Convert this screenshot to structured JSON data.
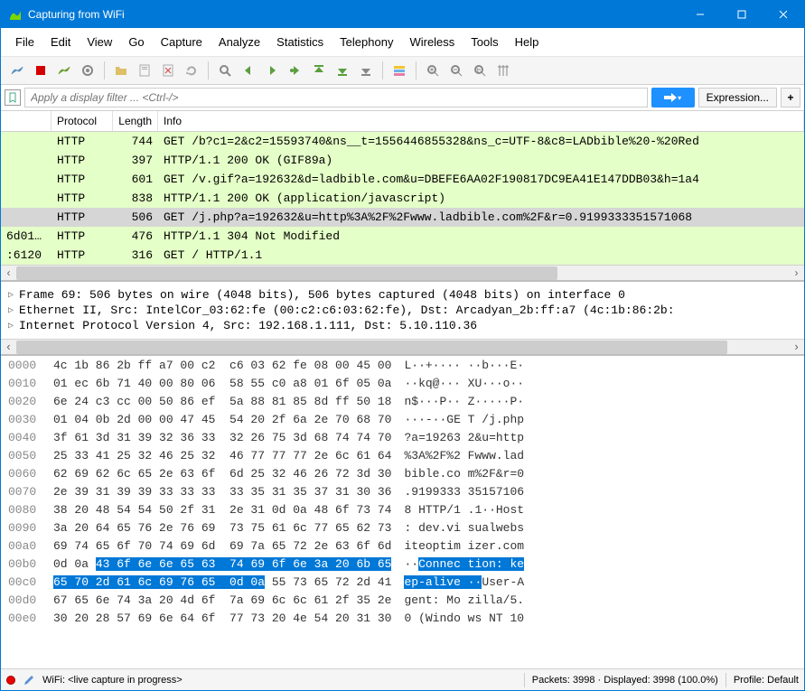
{
  "window": {
    "title": "Capturing from WiFi"
  },
  "menu": [
    "File",
    "Edit",
    "View",
    "Go",
    "Capture",
    "Analyze",
    "Statistics",
    "Telephony",
    "Wireless",
    "Tools",
    "Help"
  ],
  "filter": {
    "placeholder": "Apply a display filter ... <Ctrl-/>",
    "expression": "Expression..."
  },
  "columns": {
    "protocol": "Protocol",
    "length": "Length",
    "info": "Info"
  },
  "packets": [
    {
      "src": "",
      "proto": "HTTP",
      "len": "744",
      "info": "GET /b?c1=2&c2=15593740&ns__t=1556446855328&ns_c=UTF-8&c8=LADbible%20-%20Red",
      "cls": "green"
    },
    {
      "src": "",
      "proto": "HTTP",
      "len": "397",
      "info": "HTTP/1.1 200 OK  (GIF89a)",
      "cls": "green"
    },
    {
      "src": "",
      "proto": "HTTP",
      "len": "601",
      "info": "GET /v.gif?a=192632&d=ladbible.com&u=DBEFE6AA02F190817DC9EA41E147DDB03&h=1a4",
      "cls": "green"
    },
    {
      "src": "",
      "proto": "HTTP",
      "len": "838",
      "info": "HTTP/1.1 200 OK  (application/javascript)",
      "cls": "green"
    },
    {
      "src": "",
      "proto": "HTTP",
      "len": "506",
      "info": "GET /j.php?a=192632&u=http%3A%2F%2Fwww.ladbible.com%2F&r=0.9199333351571068",
      "cls": "selected"
    },
    {
      "src": "6d01…",
      "proto": "HTTP",
      "len": "476",
      "info": "HTTP/1.1 304 Not Modified",
      "cls": "green"
    },
    {
      "src": ":6120",
      "proto": "HTTP",
      "len": "316",
      "info": "GET / HTTP/1.1",
      "cls": "green"
    }
  ],
  "details": [
    "Frame 69: 506 bytes on wire (4048 bits), 506 bytes captured (4048 bits) on interface 0",
    "Ethernet II, Src: IntelCor_03:62:fe (00:c2:c6:03:62:fe), Dst: Arcadyan_2b:ff:a7 (4c:1b:86:2b:",
    "Internet Protocol Version 4, Src: 192.168.1.111, Dst: 5.10.110.36"
  ],
  "hex": [
    {
      "off": "0000",
      "b": "4c 1b 86 2b ff a7 00 c2  c6 03 62 fe 08 00 45 00",
      "a": "L··+···· ··b···E·"
    },
    {
      "off": "0010",
      "b": "01 ec 6b 71 40 00 80 06  58 55 c0 a8 01 6f 05 0a",
      "a": "··kq@··· XU···o··"
    },
    {
      "off": "0020",
      "b": "6e 24 c3 cc 00 50 86 ef  5a 88 81 85 8d ff 50 18",
      "a": "n$···P·· Z·····P·"
    },
    {
      "off": "0030",
      "b": "01 04 0b 2d 00 00 47 45  54 20 2f 6a 2e 70 68 70",
      "a": "···-··GE T /j.php"
    },
    {
      "off": "0040",
      "b": "3f 61 3d 31 39 32 36 33  32 26 75 3d 68 74 74 70",
      "a": "?a=19263 2&u=http"
    },
    {
      "off": "0050",
      "b": "25 33 41 25 32 46 25 32  46 77 77 77 2e 6c 61 64",
      "a": "%3A%2F%2 Fwww.lad"
    },
    {
      "off": "0060",
      "b": "62 69 62 6c 65 2e 63 6f  6d 25 32 46 26 72 3d 30",
      "a": "bible.co m%2F&r=0"
    },
    {
      "off": "0070",
      "b": "2e 39 31 39 39 33 33 33  33 35 31 35 37 31 30 36",
      "a": ".9199333 35157106"
    },
    {
      "off": "0080",
      "b": "38 20 48 54 54 50 2f 31  2e 31 0d 0a 48 6f 73 74",
      "a": "8 HTTP/1 .1··Host"
    },
    {
      "off": "0090",
      "b": "3a 20 64 65 76 2e 76 69  73 75 61 6c 77 65 62 73",
      "a": ": dev.vi sualwebs"
    },
    {
      "off": "00a0",
      "b": "69 74 65 6f 70 74 69 6d  69 7a 65 72 2e 63 6f 6d",
      "a": "iteoptim izer.com"
    }
  ],
  "hexhl": [
    {
      "off": "00b0",
      "b_pre": "0d 0a ",
      "b_hl": "43 6f 6e 6e 65 63  74 69 6f 6e 3a 20 6b 65",
      "a_pre": "··",
      "a_hl": "Connec tion: ke"
    },
    {
      "off": "00c0",
      "b_hl": "65 70 2d 61 6c 69 76 65  0d 0a",
      "b_post": " 55 73 65 72 2d 41",
      "a_hl": "ep-alive ··",
      "a_post": "User-A"
    }
  ],
  "hex2": [
    {
      "off": "00d0",
      "b": "67 65 6e 74 3a 20 4d 6f  7a 69 6c 6c 61 2f 35 2e",
      "a": "gent: Mo zilla/5."
    },
    {
      "off": "00e0",
      "b": "30 20 28 57 69 6e 64 6f  77 73 20 4e 54 20 31 30",
      "a": "0 (Windo ws NT 10"
    }
  ],
  "status": {
    "left": "WiFi: <live capture in progress>",
    "mid": "Packets: 3998 · Displayed: 3998 (100.0%)",
    "right": "Profile: Default"
  }
}
